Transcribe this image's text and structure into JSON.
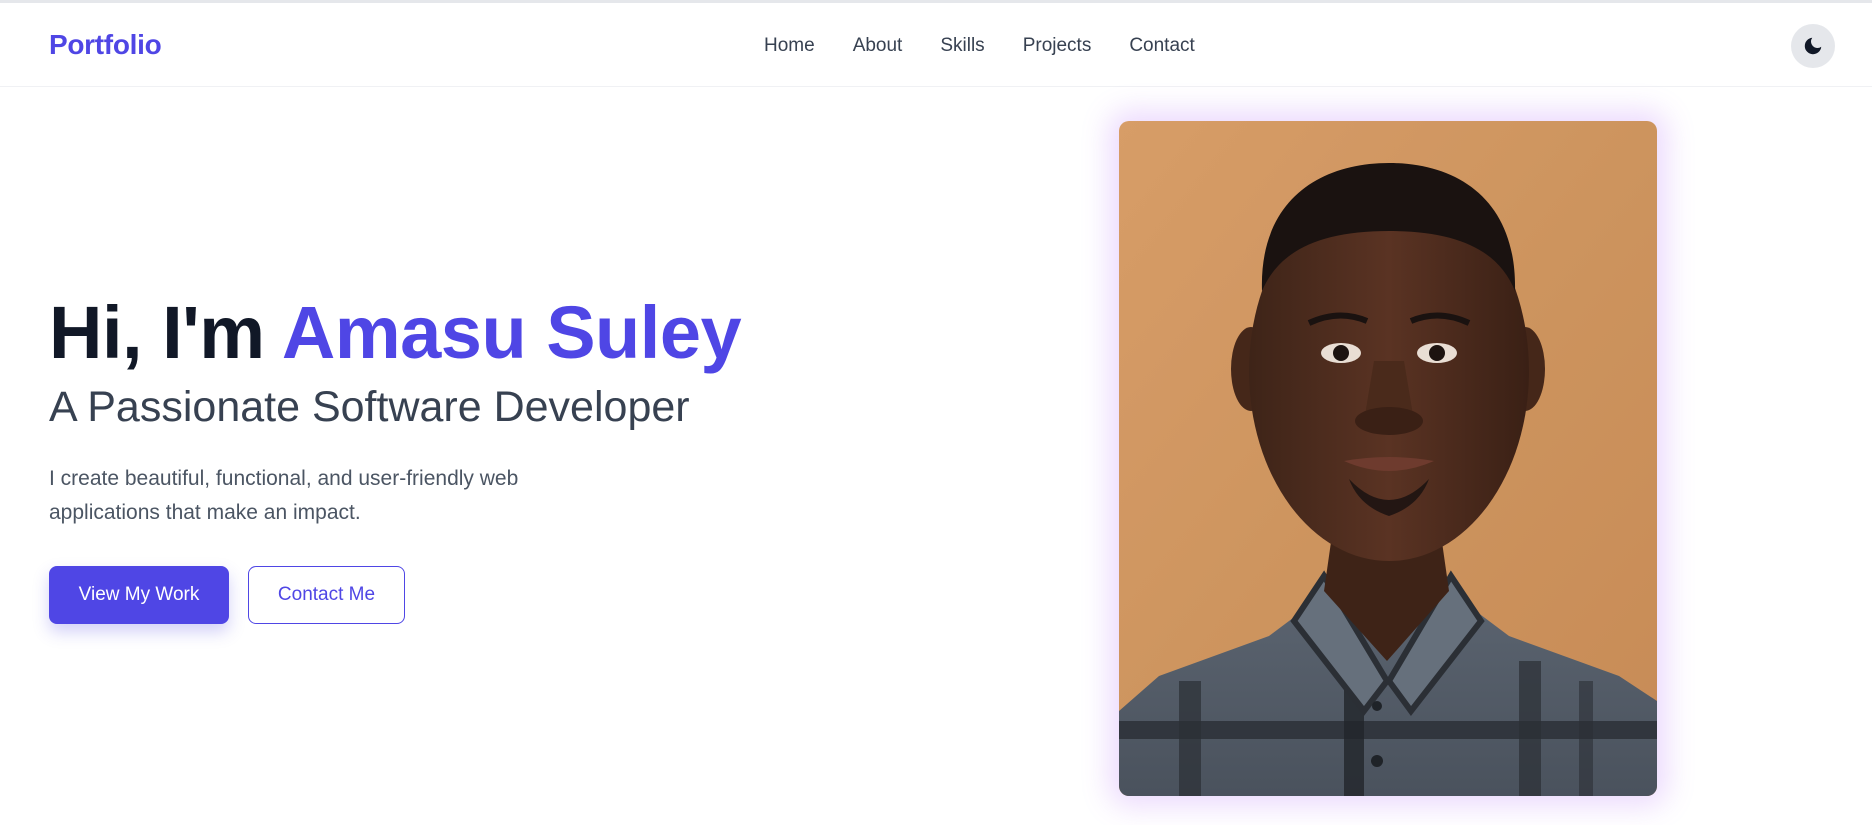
{
  "nav": {
    "brand": "Portfolio",
    "links": [
      "Home",
      "About",
      "Skills",
      "Projects",
      "Contact"
    ],
    "theme_toggle_icon": "moon-icon"
  },
  "hero": {
    "greeting": "Hi, I'm ",
    "name": "Amasu Suley",
    "subtitle": "A Passionate Software Developer",
    "description": "I create beautiful, functional, and user-friendly web applications that make an impact.",
    "primary_button": "View My Work",
    "secondary_button": "Contact Me"
  },
  "colors": {
    "accent": "#4f46e5",
    "heading": "#111827",
    "body_text": "#374151",
    "photo_glow": "#a855f7"
  }
}
